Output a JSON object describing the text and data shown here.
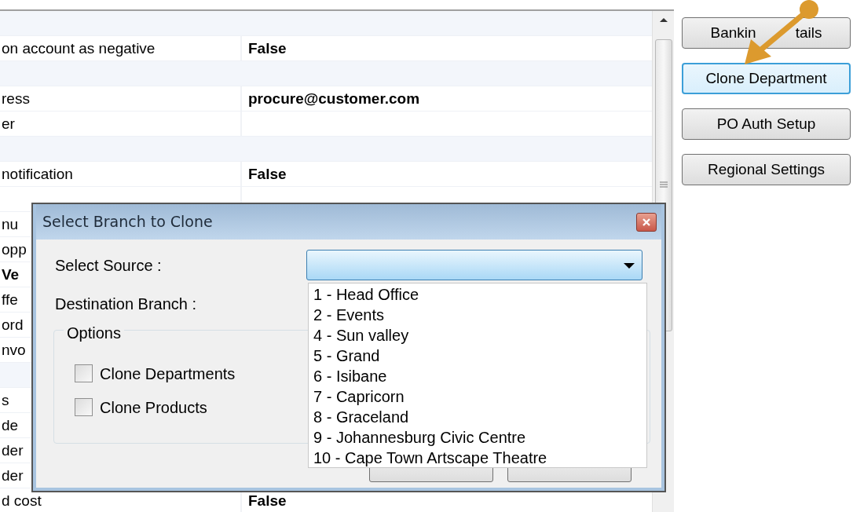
{
  "property_grid": {
    "rows": [
      {
        "kind": "category"
      },
      {
        "kind": "property",
        "label": "on account as negative",
        "value": "False"
      },
      {
        "kind": "category"
      },
      {
        "kind": "property",
        "label": "ress",
        "value": "procure@customer.com"
      },
      {
        "kind": "property",
        "label": "er"
      },
      {
        "kind": "category"
      },
      {
        "kind": "property",
        "label": "notification",
        "value": "False"
      },
      {
        "kind": "property"
      },
      {
        "kind": "property",
        "label": "nu"
      },
      {
        "kind": "property",
        "label": "opp"
      },
      {
        "kind": "property",
        "label": "Ve",
        "label_bold": true
      },
      {
        "kind": "property",
        "label": "ffe"
      },
      {
        "kind": "property",
        "label": "ord"
      },
      {
        "kind": "property",
        "label": "nvo"
      },
      {
        "kind": "category"
      },
      {
        "kind": "property",
        "label": "s"
      },
      {
        "kind": "property",
        "label": "de"
      },
      {
        "kind": "property",
        "label": "der"
      },
      {
        "kind": "property",
        "label": "der"
      },
      {
        "kind": "property",
        "label": "d cost",
        "value": "False"
      }
    ]
  },
  "side_buttons": [
    {
      "label_parts": [
        "Bankin",
        "tails"
      ],
      "focused": false
    },
    {
      "label": "Clone Department",
      "focused": true
    },
    {
      "label": "PO Auth Setup",
      "focused": false
    },
    {
      "label": "Regional Settings",
      "focused": false
    }
  ],
  "dialog": {
    "title": "Select Branch to Clone",
    "source_label": "Select Source :",
    "destination_label": "Destination Branch :",
    "options_title": "Options",
    "options": [
      {
        "label": "Clone Departments",
        "checked": false
      },
      {
        "label": "Clone Products",
        "checked": false
      }
    ],
    "dropdown_items": [
      "1 - Head Office",
      "2 - Events",
      "4 - Sun valley",
      "5 - Grand",
      "6 - Isibane",
      "7 - Capricorn",
      "8 - Graceland",
      "9 - Johannesburg Civic Centre",
      "10 - Cape Town Artscape Theatre"
    ]
  }
}
